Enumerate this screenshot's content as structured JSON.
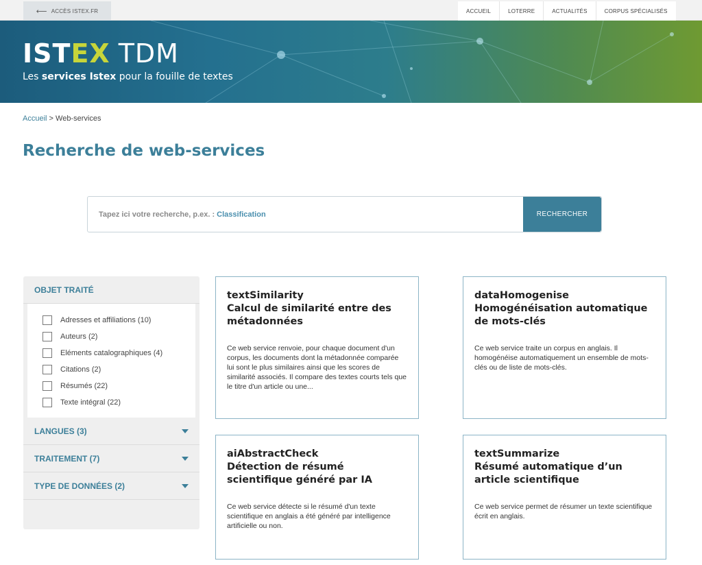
{
  "topbar": {
    "back_label": "ACCÈS ISTEX.FR",
    "nav": [
      "ACCUEIL",
      "LOTERRE",
      "ACTUALITÉS",
      "CORPUS SPÉCIALISÉS"
    ]
  },
  "banner": {
    "brand_ist": "IST",
    "brand_ex": "EX",
    "brand_tdm": "TDM",
    "tagline_pre": "Les ",
    "tagline_bold": "services Istex",
    "tagline_post": " pour la fouille de textes"
  },
  "breadcrumb": {
    "home": "Accueil",
    "sep": " > ",
    "current": "Web-services"
  },
  "page_title": "Recherche de web-services",
  "search": {
    "placeholder_prefix": "Tapez ici votre recherche, p.ex. :",
    "placeholder_hint": "Classification",
    "button": "RECHERCHER"
  },
  "filters": {
    "objet_title": "OBJET TRAITÉ",
    "objet_items": [
      "Adresses et affiliations (10)",
      "Auteurs (2)",
      "Eléments catalographiques (4)",
      "Citations (2)",
      "Résumés (22)",
      "Texte intégral (22)"
    ],
    "langues": "LANGUES (3)",
    "traitement": "TRAITEMENT (7)",
    "type_donnees": "TYPE DE DONNÉES (2)"
  },
  "cards": [
    {
      "name": "textSimilarity",
      "title": "Calcul de similarité entre des métadonnées",
      "desc": "Ce web service renvoie, pour chaque document d'un corpus, les documents dont la métadonnée comparée lui sont le plus similaires ainsi que les scores de similarité associés. Il compare des textes courts tels que le titre d'un article ou une..."
    },
    {
      "name": "dataHomogenise",
      "title": "Homogénéisation automatique de mots-clés",
      "desc": "Ce web service traite un corpus en anglais. Il homogénéise automatiquement un ensemble de mots-clés ou de liste de mots-clés."
    },
    {
      "name": "aiAbstractCheck",
      "title": "Détection de résumé scientifique généré par IA",
      "desc": "Ce web service détecte si le résumé d'un texte scientifique en anglais a été généré par intelligence artificielle ou non."
    },
    {
      "name": "textSummarize",
      "title": "Résumé automatique d’un article scientifique",
      "desc": "Ce web service permet de résumer un texte scientifique écrit en anglais."
    }
  ],
  "colors": {
    "accent": "#3c7f99",
    "brand_green": "#c7d53a"
  }
}
